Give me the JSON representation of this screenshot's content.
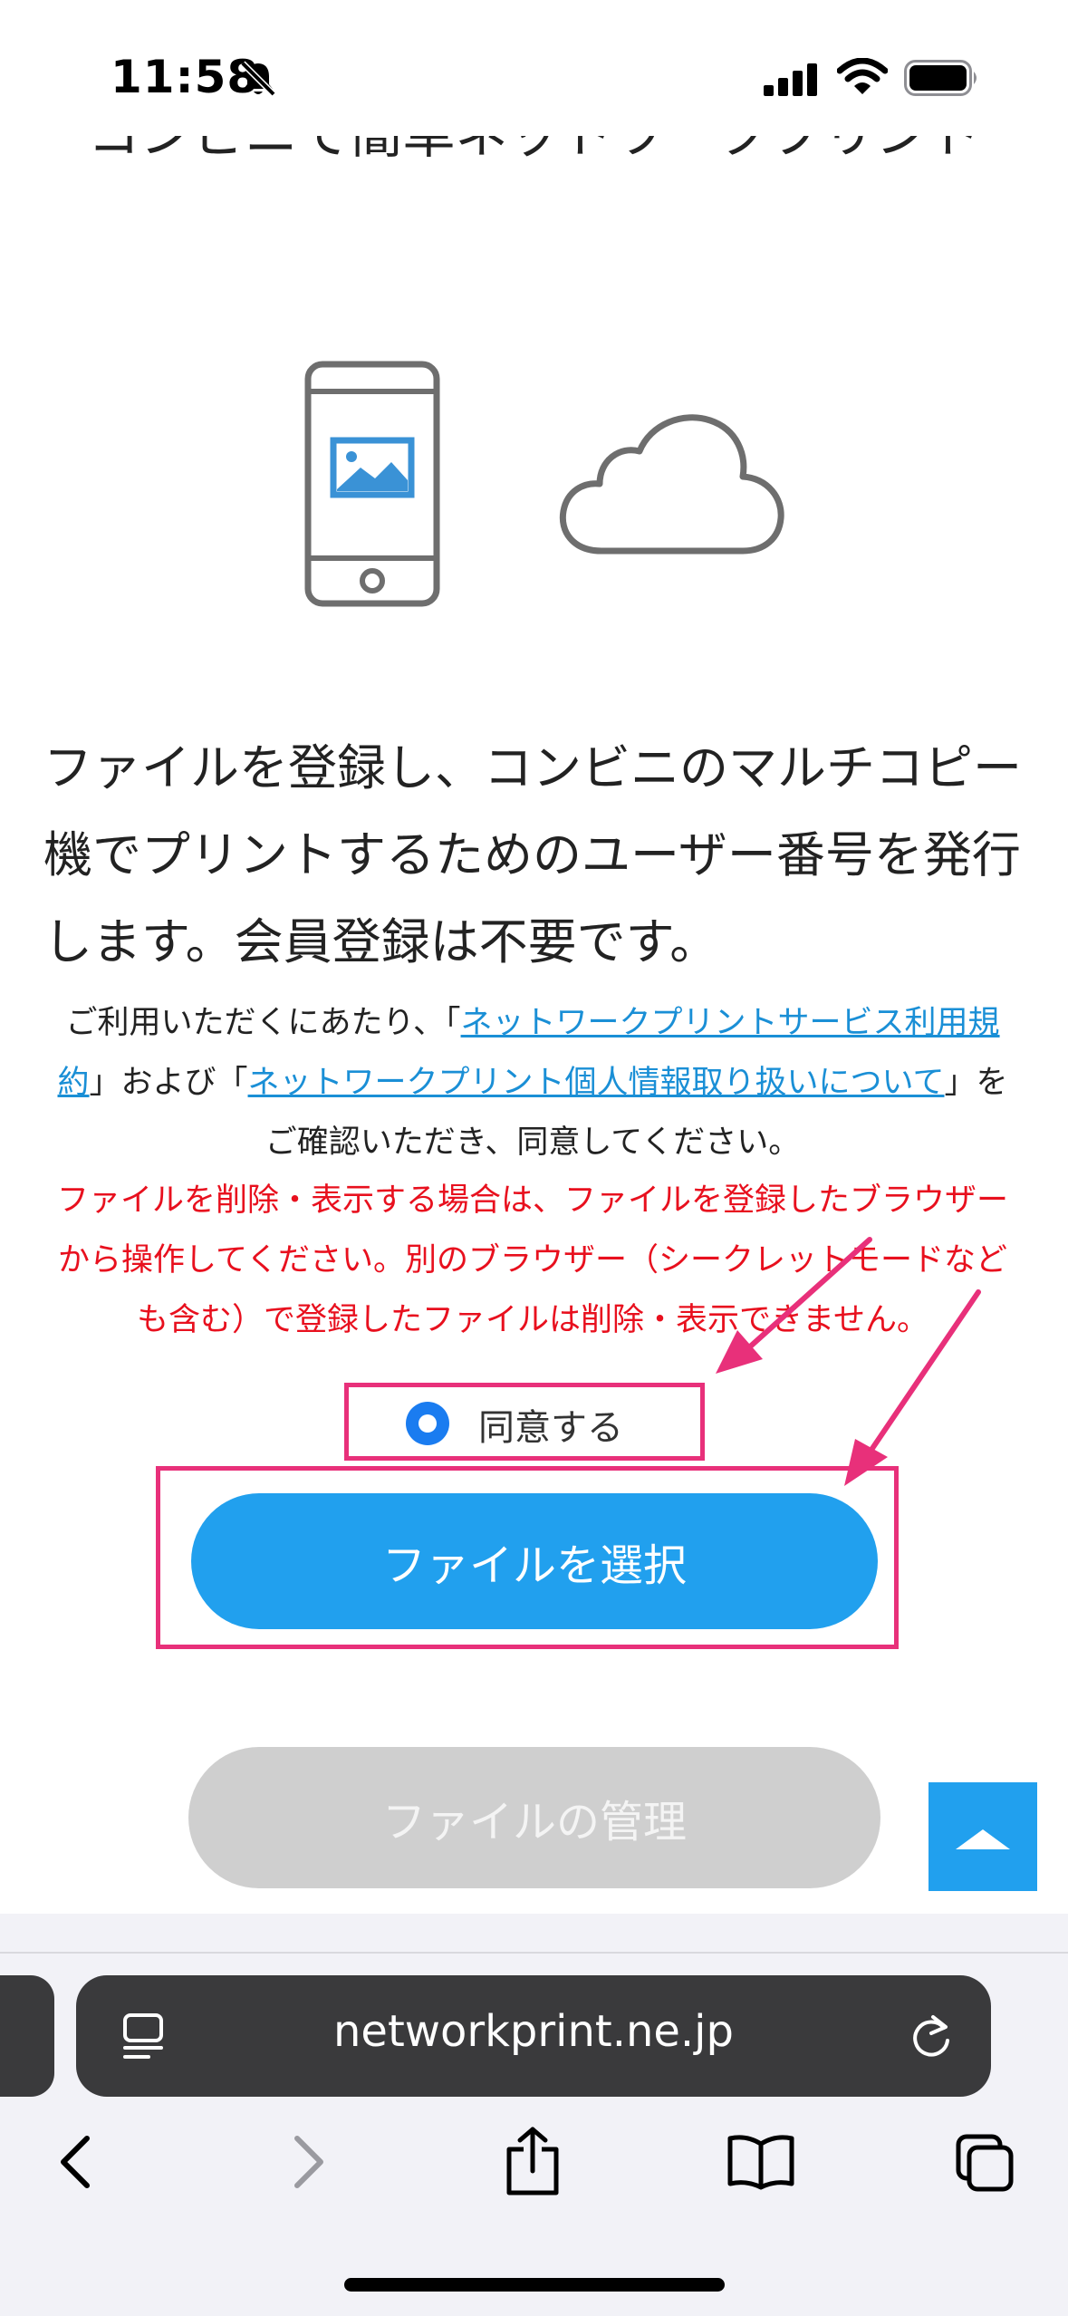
{
  "status_bar": {
    "time": "11:58"
  },
  "page": {
    "heading_cut": "コンビニで簡単ネットワークプリント",
    "description": "ファイルを登録し、コンビニのマルチコピー機でプリントするためのユーザー番号を発行します。会員登録は不要です。",
    "terms": {
      "prefix": "ご利用いただくにあたり、「",
      "link1": "ネットワークプリントサービス利用規約",
      "middle": "」および「",
      "link2": "ネットワークプリント個人情報取り扱いについて",
      "suffix": "」をご確認いただき、同意してください。"
    },
    "warning": "ファイルを削除・表示する場合は、ファイルを登録したブラウザーから操作してください。別のブラウザー（シークレットモードなども含む）で登録したファイルは削除・表示できません。",
    "agree_label": "同意する",
    "select_button": "ファイルを選択",
    "manage_button": "ファイルの管理"
  },
  "browser": {
    "url": "networkprint.ne.jp"
  },
  "colors": {
    "accent": "#21a0ee",
    "warning": "#e8101e",
    "annotation": "#e8307a",
    "disabled": "#cfcfcf"
  },
  "icons": [
    "bell-slash-icon",
    "signal-icon",
    "wifi-icon",
    "battery-icon",
    "smartphone-image-icon",
    "cloud-icon",
    "scroll-top-icon",
    "reader-icon",
    "reload-icon",
    "back-icon",
    "forward-icon",
    "share-icon",
    "bookmarks-icon",
    "tabs-icon"
  ]
}
